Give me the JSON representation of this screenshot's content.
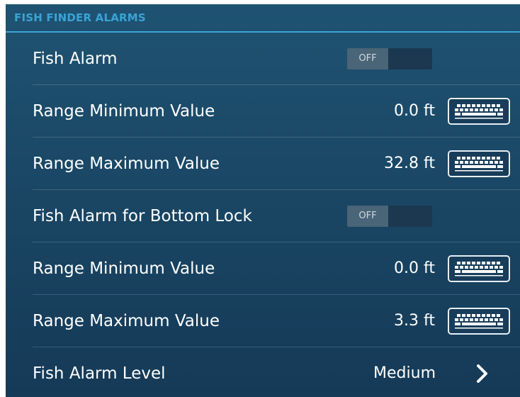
{
  "header": {
    "title": "FISH FINDER ALARMS"
  },
  "rows": [
    {
      "label": "Fish Alarm",
      "toggle": "OFF"
    },
    {
      "label": "Range Minimum Value",
      "value": "0.0 ft",
      "icon": "keyboard-icon"
    },
    {
      "label": "Range Maximum Value",
      "value": "32.8 ft",
      "icon": "keyboard-icon"
    },
    {
      "label": "Fish Alarm for Bottom Lock",
      "toggle": "OFF"
    },
    {
      "label": "Range Minimum Value",
      "value": "0.0 ft",
      "icon": "keyboard-icon"
    },
    {
      "label": "Range Maximum Value",
      "value": "3.3 ft",
      "icon": "keyboard-icon"
    },
    {
      "label": "Fish Alarm Level",
      "value": "Medium",
      "icon": "chevron-right-icon"
    }
  ],
  "colors": {
    "accent": "#3aa3d6",
    "panel_top": "#1f5372",
    "panel_bottom": "#153a57"
  }
}
